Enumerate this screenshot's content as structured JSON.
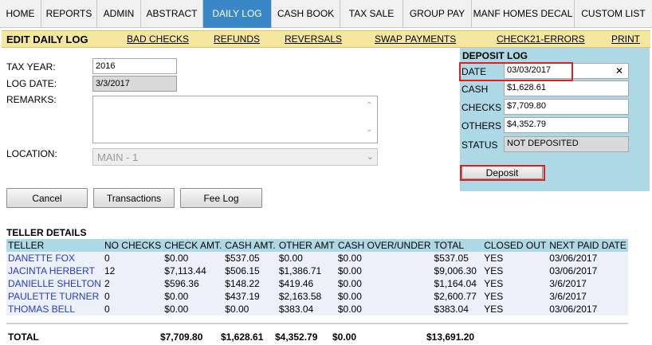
{
  "nav": {
    "tabs": [
      "HOME",
      "REPORTS",
      "ADMIN",
      "ABSTRACT",
      "DAILY LOG",
      "CASH BOOK",
      "TAX SALE",
      "GROUP PAY",
      "MANF HOMES DECAL",
      "CUSTOM LIST"
    ],
    "active": "DAILY LOG"
  },
  "subnav": {
    "title": "EDIT DAILY LOG",
    "links": [
      "BAD CHECKS",
      "REFUNDS",
      "REVERSALS",
      "SWAP PAYMENTS",
      "CHECK21-ERRORS",
      "PRINT"
    ]
  },
  "form": {
    "tax_year_label": "TAX YEAR:",
    "tax_year_value": "2016",
    "log_date_label": "LOG DATE:",
    "log_date_value": "3/3/2017",
    "remarks_label": "REMARKS:",
    "remarks_value": "",
    "location_label": "LOCATION:",
    "location_value": "MAIN - 1"
  },
  "buttons": {
    "cancel": "Cancel",
    "transactions": "Transactions",
    "fee_log": "Fee Log",
    "deposit": "Deposit"
  },
  "deposit_log": {
    "title": "DEPOSIT LOG",
    "date_label": "DATE",
    "date_value": "03/03/2017",
    "cash_label": "CASH",
    "cash_value": "$1,628.61",
    "checks_label": "CHECKS",
    "checks_value": "$7,709.80",
    "others_label": "OTHERS",
    "others_value": "$4,352.79",
    "status_label": "STATUS",
    "status_value": "NOT DEPOSITED",
    "highlight_color": "#e0201f"
  },
  "teller_details": {
    "title": "TELLER DETAILS",
    "columns": [
      "TELLER",
      "NO CHECKS",
      "CHECK AMT.",
      "CASH AMT.",
      "OTHER AMT",
      "CASH OVER/UNDER",
      "TOTAL",
      "CLOSED OUT",
      "NEXT PAID DATE"
    ],
    "rows": [
      [
        "DANETTE FOX",
        "0",
        "$0.00",
        "$537.05",
        "$0.00",
        "$0.00",
        "$537.05",
        "YES",
        "03/06/2017"
      ],
      [
        "JACINTA HERBERT",
        "12",
        "$7,113.44",
        "$506.15",
        "$1,386.71",
        "$0.00",
        "$9,006.30",
        "YES",
        "03/06/2017"
      ],
      [
        "DANIELLE SHELTON",
        "2",
        "$596.36",
        "$148.22",
        "$419.46",
        "$0.00",
        "$1,164.04",
        "YES",
        "3/6/2017"
      ],
      [
        "PAULETTE TURNER",
        "0",
        "$0.00",
        "$437.19",
        "$2,163.58",
        "$0.00",
        "$2,600.77",
        "YES",
        "3/6/2017"
      ],
      [
        "THOMAS BELL",
        "0",
        "$0.00",
        "$0.00",
        "$383.04",
        "$0.00",
        "$383.04",
        "YES",
        "03/06/2017"
      ]
    ],
    "totals": {
      "label": "TOTAL",
      "check_amt": "$7,709.80",
      "cash_amt": "$1,628.61",
      "other_amt": "$4,352.79",
      "cash_over_under": "$0.00",
      "total": "$13,691.20"
    }
  },
  "colors": {
    "nav_active": "#3a87c8",
    "subnav_bg": "#f6e7a0",
    "panel_bg": "#add8e6",
    "teller_link": "#1f3fbf"
  }
}
